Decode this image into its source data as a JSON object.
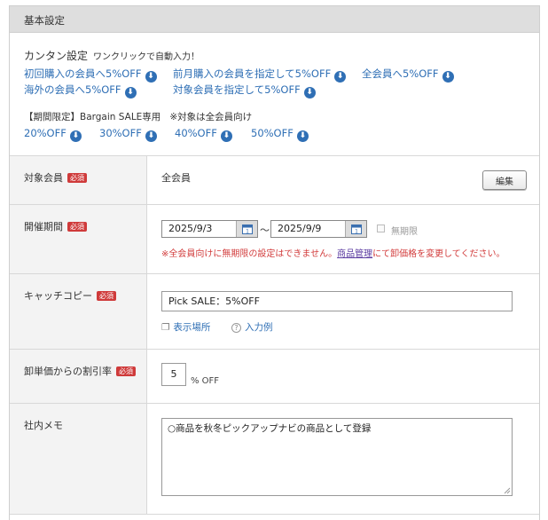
{
  "panel": {
    "title": "基本設定"
  },
  "easy": {
    "title": "カンタン設定",
    "subtitle": "ワンクリックで自動入力！",
    "links": [
      "初回購入の会員へ5%OFF",
      "前月購入の会員を指定して5%OFF",
      "全会員へ5%OFF",
      "海外の会員へ5%OFF",
      "対象会員を指定して5%OFF"
    ],
    "limited_label": "【期間限定】Bargain SALE専用",
    "limited_note": "※対象は全会員向け",
    "sale_links": [
      "20%OFF",
      "30%OFF",
      "40%OFF",
      "50%OFF"
    ],
    "download_icon": "arrow-down-circle-icon"
  },
  "required_badge": "必須",
  "target": {
    "label": "対象会員",
    "value": "全会員",
    "edit_button": "編集"
  },
  "period": {
    "label": "開催期間",
    "start_date": "2025/9/3",
    "tilde": "～",
    "end_date": "2025/9/9",
    "unlimited_label": "無期限",
    "unlimited_checked": false,
    "warning_before": "※全会員向けに無期限の設定はできません。",
    "warning_link": "商品管理",
    "warning_after": "にて卸価格を変更してください。",
    "calendar_icon": "calendar-icon"
  },
  "catch": {
    "label": "キャッチコピー",
    "value": "Pick SALE：5%OFF",
    "display_link": "表示場所",
    "example_link": "入力例"
  },
  "discount": {
    "label": "卸単価からの割引率",
    "value": "5",
    "unit": "% OFF"
  },
  "memo": {
    "label": "社内メモ",
    "value": "○商品を秋冬ピックアップナビの商品として登録"
  },
  "colors": {
    "link": "#2f6fb5",
    "required": "#cf3a3a",
    "warning": "#d23c3c",
    "header_bg": "#dedede",
    "label_bg": "#f3f3f3"
  }
}
